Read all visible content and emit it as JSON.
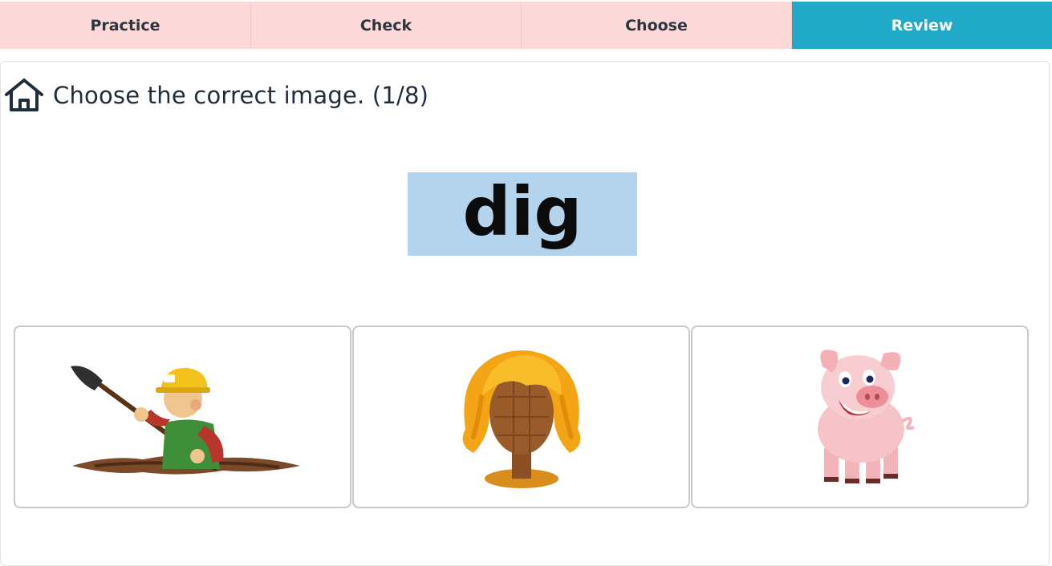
{
  "tabs": [
    {
      "label": "Practice",
      "active": false
    },
    {
      "label": "Check",
      "active": false
    },
    {
      "label": "Choose",
      "active": false
    },
    {
      "label": "Review",
      "active": true
    }
  ],
  "header": {
    "icon": "home-icon",
    "instruction": "Choose the correct image. (1/8)"
  },
  "prompt": {
    "word": "dig"
  },
  "options": [
    {
      "name": "digging-worker",
      "icon": "man-digging-image"
    },
    {
      "name": "wig",
      "icon": "wig-image"
    },
    {
      "name": "pig",
      "icon": "pig-image"
    }
  ],
  "colors": {
    "tab_bg": "#fdd9d9",
    "tab_active": "#21aac8",
    "word_bg": "#b4d3ed",
    "text": "#1f2d3a"
  }
}
